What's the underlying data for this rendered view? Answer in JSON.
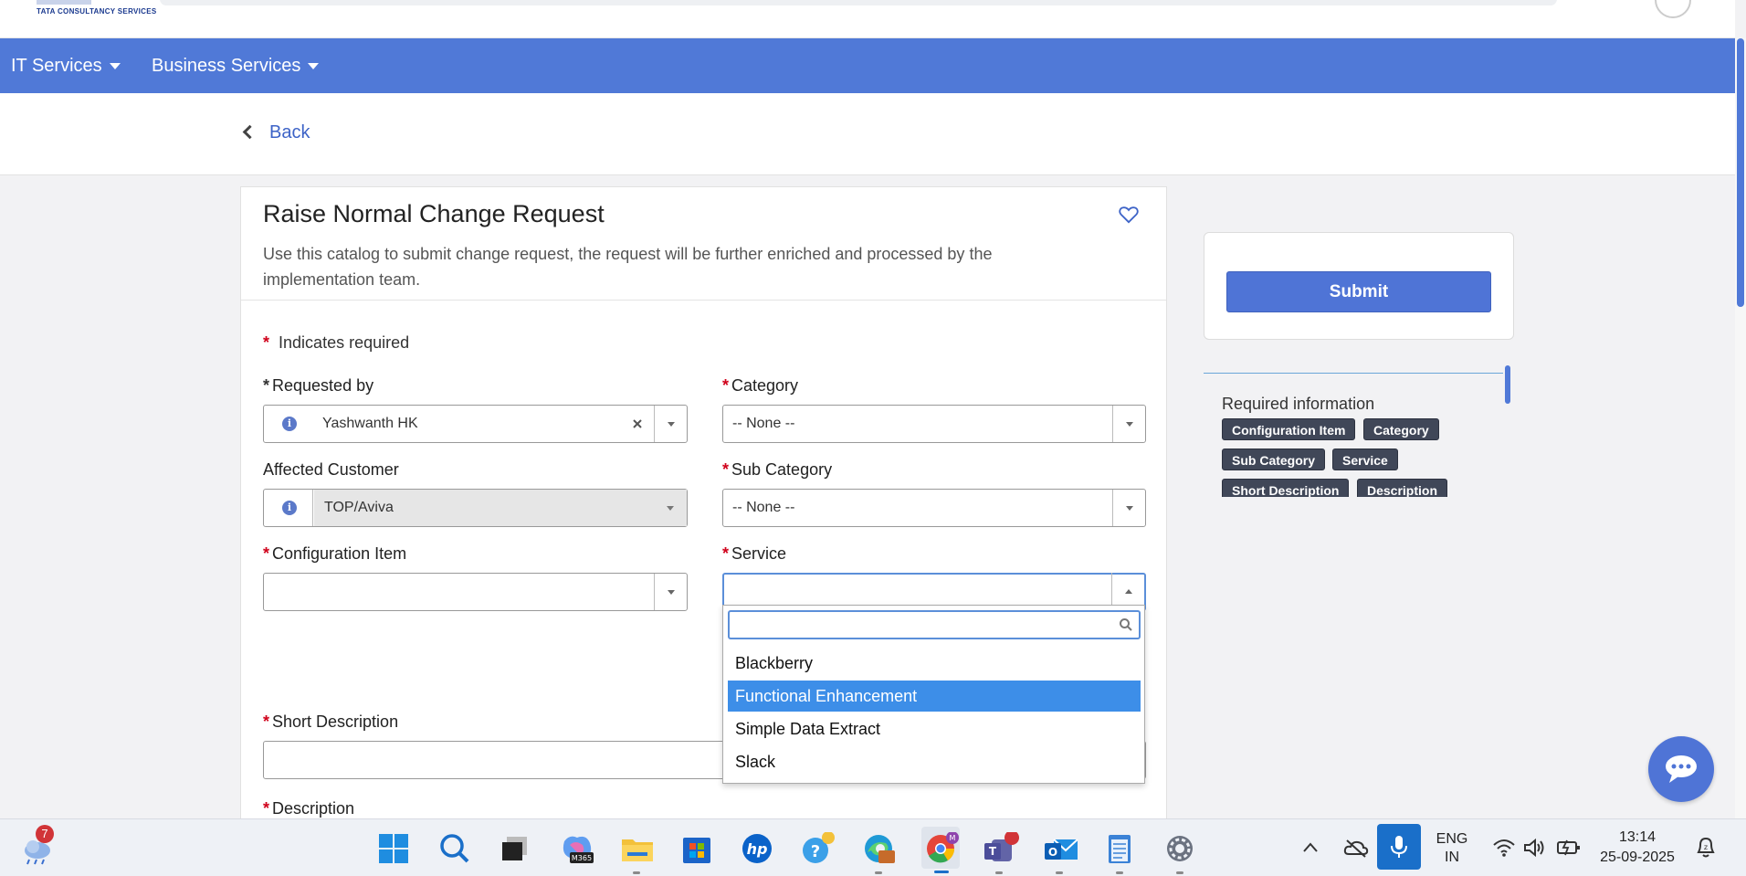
{
  "header": {
    "logo_text": "TATA CONSULTANCY SERVICES"
  },
  "nav": {
    "items": [
      {
        "label": "IT Services"
      },
      {
        "label": "Business Services"
      }
    ]
  },
  "back": {
    "label": "Back"
  },
  "form": {
    "title": "Raise Normal Change Request",
    "description": "Use this catalog to submit change request, the request will be further enriched and processed by the implementation team.",
    "required_note": "Indicates required",
    "requested_by": {
      "label": "Requested by",
      "value": "Yashwanth HK"
    },
    "category": {
      "label": "Category",
      "value": "-- None --"
    },
    "affected_customer": {
      "label": "Affected Customer",
      "value": "TOP/Aviva"
    },
    "sub_category": {
      "label": "Sub Category",
      "value": "-- None --"
    },
    "configuration_item": {
      "label": "Configuration Item",
      "value": ""
    },
    "service": {
      "label": "Service",
      "value": "",
      "search_value": "",
      "options": [
        "Blackberry",
        "Functional Enhancement",
        "Simple Data Extract",
        "Slack"
      ],
      "highlighted": "Functional Enhancement"
    },
    "short_description": {
      "label": "Short Description",
      "value": ""
    },
    "description_field": {
      "label": "Description"
    }
  },
  "side": {
    "submit_label": "Submit",
    "required_info_title": "Required information",
    "required_tags": [
      "Configuration Item",
      "Category",
      "Sub Category",
      "Service",
      "Short Description",
      "Description"
    ]
  },
  "taskbar": {
    "weather_badge": "7",
    "lang_line1": "ENG",
    "lang_line2": "IN",
    "time": "13:14",
    "date": "25-09-2025",
    "icons": [
      "weather-icon",
      "start-icon",
      "search-icon",
      "task-view-icon",
      "m365-icon",
      "file-explorer-icon",
      "store-icon",
      "hp-icon",
      "help-icon",
      "edge-icon",
      "chrome-icon",
      "teams-icon",
      "outlook-icon",
      "notepad-icon",
      "settings-icon"
    ]
  },
  "colors": {
    "accent": "#5079d7",
    "highlight": "#3d8ee8",
    "required": "#d0021b",
    "tag": "#404758"
  }
}
